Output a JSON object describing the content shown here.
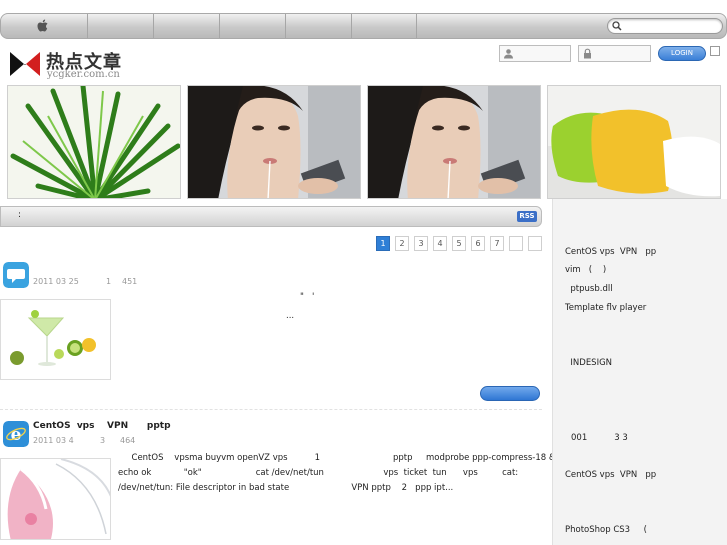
{
  "site": {
    "title": "热点文章",
    "domain": "ycgker.com.cn"
  },
  "topbar": {
    "nav_items": [
      "",
      "",
      "",
      "",
      ""
    ],
    "search_placeholder": ""
  },
  "login": {
    "username_placeholder": "",
    "password_placeholder": "",
    "button_label": "LOGIN"
  },
  "section": {
    "label": ":",
    "rss_label": "RSS"
  },
  "pagination": {
    "pages": [
      "1",
      "2",
      "3",
      "4",
      "5",
      "6",
      "7",
      "",
      ""
    ],
    "current": "1"
  },
  "posts": [
    {
      "title": "",
      "date": "2011 03 25",
      "comments": "1",
      "views": "451",
      "excerpt_lines": [
        "\"   '",
        "..."
      ]
    },
    {
      "title": "CentOS  vps    VPN      pptp",
      "date": "2011 03 4",
      "comments": "3",
      "views": "464",
      "excerpt_lines": [
        "     CentOS    vpsma buyvm openVZ vps          1                           pptp     modprobe ppp-compress-18 &&",
        "echo ok            \"ok\"                    cat /dev/net/tun                      vps  ticket  tun      vps         cat:",
        "/dev/net/tun: File descriptor in bad state                       VPN pptp    2   ppp ipt..."
      ]
    }
  ],
  "sidebar": {
    "items": [
      "CentOS vps  VPN   pp",
      "vim   (    )",
      "  ptpusb.dll",
      "Template flv player",
      "  INDESIGN",
      "001          3 3",
      "CentOS vps  VPN   pp",
      "PhotoShop CS3     ("
    ]
  },
  "colors": {
    "accent_blue": "#2f7fd6",
    "topbar_gray": "#c9c9c9",
    "sidebar_bg": "#f3f3f3"
  },
  "icons": {
    "post1": "speech-bubble-icon",
    "post2": "internet-explorer-icon"
  }
}
